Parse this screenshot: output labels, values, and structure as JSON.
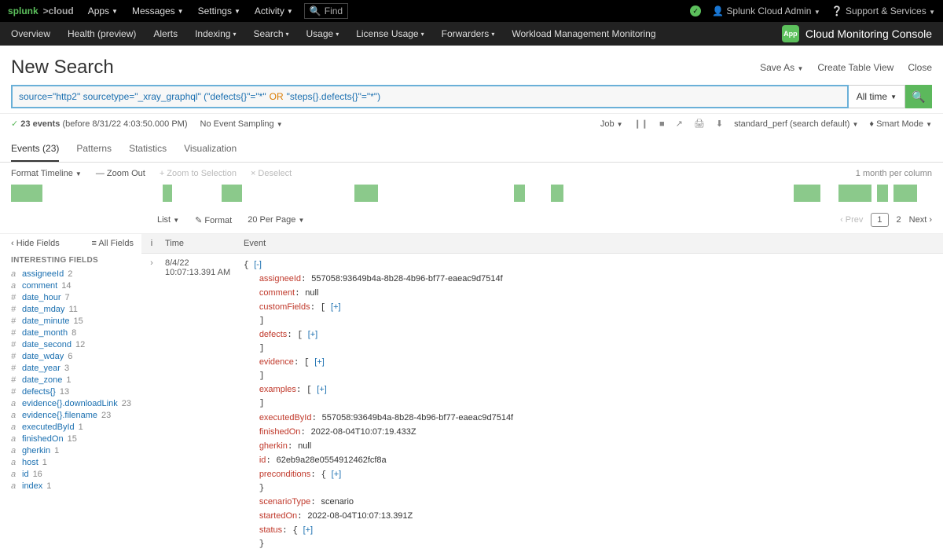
{
  "topbar": {
    "brand1": "splunk",
    "brand2": ">cloud",
    "menu": [
      "Apps",
      "Messages",
      "Settings",
      "Activity"
    ],
    "find": "Find",
    "user": "Splunk Cloud Admin",
    "support": "Support & Services"
  },
  "subbar": {
    "items": [
      "Overview",
      "Health (preview)",
      "Alerts",
      "Indexing",
      "Search",
      "Usage",
      "License Usage",
      "Forwarders",
      "Workload Management Monitoring"
    ],
    "app": "Cloud Monitoring Console",
    "appshort": "App"
  },
  "header": {
    "title": "New Search",
    "actions": [
      "Save As",
      "Create Table View",
      "Close"
    ]
  },
  "search": {
    "part1": "source=\"http2\"  sourcetype=\"_xray_graphql\" (\"defects{}\"=\"*\" ",
    "or": "OR",
    "part2": " \"steps{}.defects{}\"=\"*\")",
    "time": "All time",
    "go": "🔍"
  },
  "status": {
    "chk": "✓",
    "count": "23 events",
    "when": "(before 8/31/22 4:03:50.000 PM)",
    "sampling": "No Event Sampling",
    "job": "Job",
    "format": "standard_perf (search default)",
    "smart": "Smart Mode"
  },
  "tabs": [
    "Events (23)",
    "Patterns",
    "Statistics",
    "Visualization"
  ],
  "tl": {
    "format": "Format Timeline",
    "zoomout": "— Zoom Out",
    "zoomsel": "+ Zoom to Selection",
    "deselect": "× Deselect",
    "scale": "1 month per column"
  },
  "listbar": {
    "list": "List",
    "format": "✎ Format",
    "per": "20 Per Page",
    "prev": "‹ Prev",
    "p1": "1",
    "p2": "2",
    "next": "Next ›"
  },
  "fieldshdr": {
    "hide": "‹ Hide Fields",
    "all": "≡ All Fields"
  },
  "fheading": "INTERESTING FIELDS",
  "fields": [
    {
      "t": "a",
      "n": "assigneeId",
      "c": "2"
    },
    {
      "t": "a",
      "n": "comment",
      "c": "14"
    },
    {
      "t": "#",
      "n": "date_hour",
      "c": "7"
    },
    {
      "t": "#",
      "n": "date_mday",
      "c": "11"
    },
    {
      "t": "#",
      "n": "date_minute",
      "c": "15"
    },
    {
      "t": "#",
      "n": "date_month",
      "c": "8"
    },
    {
      "t": "#",
      "n": "date_second",
      "c": "12"
    },
    {
      "t": "#",
      "n": "date_wday",
      "c": "6"
    },
    {
      "t": "#",
      "n": "date_year",
      "c": "3"
    },
    {
      "t": "#",
      "n": "date_zone",
      "c": "1"
    },
    {
      "t": "#",
      "n": "defects{}",
      "c": "13"
    },
    {
      "t": "a",
      "n": "evidence{}.downloadLink",
      "c": "23"
    },
    {
      "t": "a",
      "n": "evidence{}.filename",
      "c": "23"
    },
    {
      "t": "a",
      "n": "executedById",
      "c": "1"
    },
    {
      "t": "a",
      "n": "finishedOn",
      "c": "15"
    },
    {
      "t": "a",
      "n": "gherkin",
      "c": "1"
    },
    {
      "t": "a",
      "n": "host",
      "c": "1"
    },
    {
      "t": "a",
      "n": "id",
      "c": "16"
    },
    {
      "t": "a",
      "n": "index",
      "c": "1"
    }
  ],
  "evh": {
    "i": "i",
    "time": "Time",
    "event": "Event"
  },
  "ev": {
    "date": "8/4/22",
    "time": "10:07:13.391 AM",
    "kv": {
      "assigneeId": "557058:93649b4a-8b28-4b96-bf77-eaeac9d7514f",
      "comment": "null",
      "customFields": "[ [+]",
      "defects": "[ [+]",
      "evidence": "[ [+]",
      "examples": "[ [+]",
      "executedById": "557058:93649b4a-8b28-4b96-bf77-eaeac9d7514f",
      "finishedOn": "2022-08-04T10:07:19.433Z",
      "gherkin": "null",
      "id": "62eb9a28e0554912462fcf8a",
      "preconditions": "{ [+]",
      "scenarioType": "scenario",
      "startedOn": "2022-08-04T10:07:13.391Z",
      "status": "{ [+]"
    }
  }
}
